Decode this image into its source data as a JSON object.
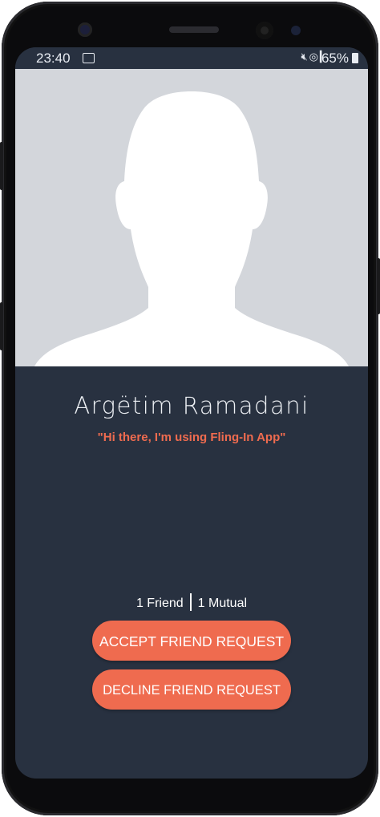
{
  "status_bar": {
    "time": "23:40",
    "image_icon": "image-icon",
    "icons": [
      "mute-icon",
      "wifi-icon",
      "signal-icon"
    ],
    "battery_text": "65%",
    "battery_icon": "battery-icon"
  },
  "profile": {
    "photo_placeholder": "avatar-silhouette",
    "name": "Argëtim Ramadani",
    "status_message": "\"Hi there, I'm using Fling-In App\"",
    "friends_text": "1 Friend",
    "mutual_text": "1 Mutual"
  },
  "actions": {
    "accept_label": "ACCEPT FRIEND REQUEST",
    "decline_label": "DECLINE FRIEND REQUEST"
  },
  "colors": {
    "background": "#283140",
    "accent": "#ef6b4f",
    "photo_background": "#d3d6db",
    "text": "#ffffff"
  }
}
